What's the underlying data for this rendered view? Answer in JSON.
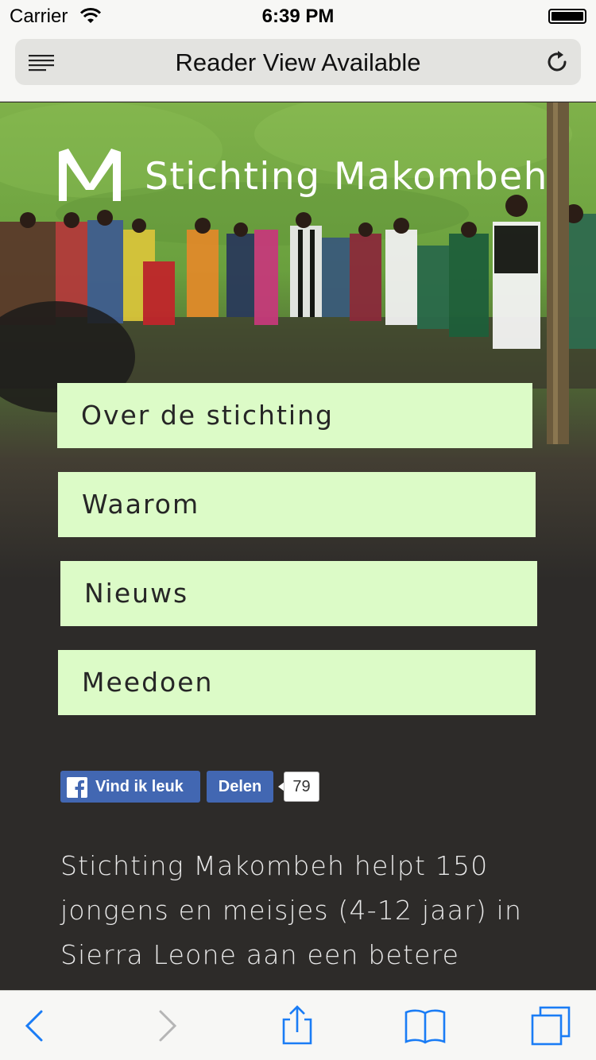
{
  "status_bar": {
    "carrier": "Carrier",
    "time": "6:39 PM"
  },
  "browser": {
    "address": "Reader View Available",
    "reader_icon": "reader-view-icon",
    "reload_icon": "reload-icon"
  },
  "site": {
    "title": "Stichting Makombeh",
    "logo_icon": "makombeh-m-logo"
  },
  "menu": [
    {
      "label": "Over de stichting"
    },
    {
      "label": "Waarom"
    },
    {
      "label": "Nieuws"
    },
    {
      "label": "Meedoen"
    }
  ],
  "social": {
    "like_label": "Vind ik leuk",
    "share_label": "Delen",
    "count": "79",
    "brand_color": "#4267b2"
  },
  "intro_text": "Stichting Makombeh helpt 150 jongens en meisjes (4-12 jaar) in Sierra Leone aan een betere",
  "toolbar": {
    "icons": [
      "back-icon",
      "forward-icon",
      "share-icon",
      "bookmarks-icon",
      "tabs-icon"
    ],
    "accent": "#1a7cf5"
  },
  "colors": {
    "menu_bg": "#dcfbc7",
    "page_bg": "#2d2b29"
  }
}
